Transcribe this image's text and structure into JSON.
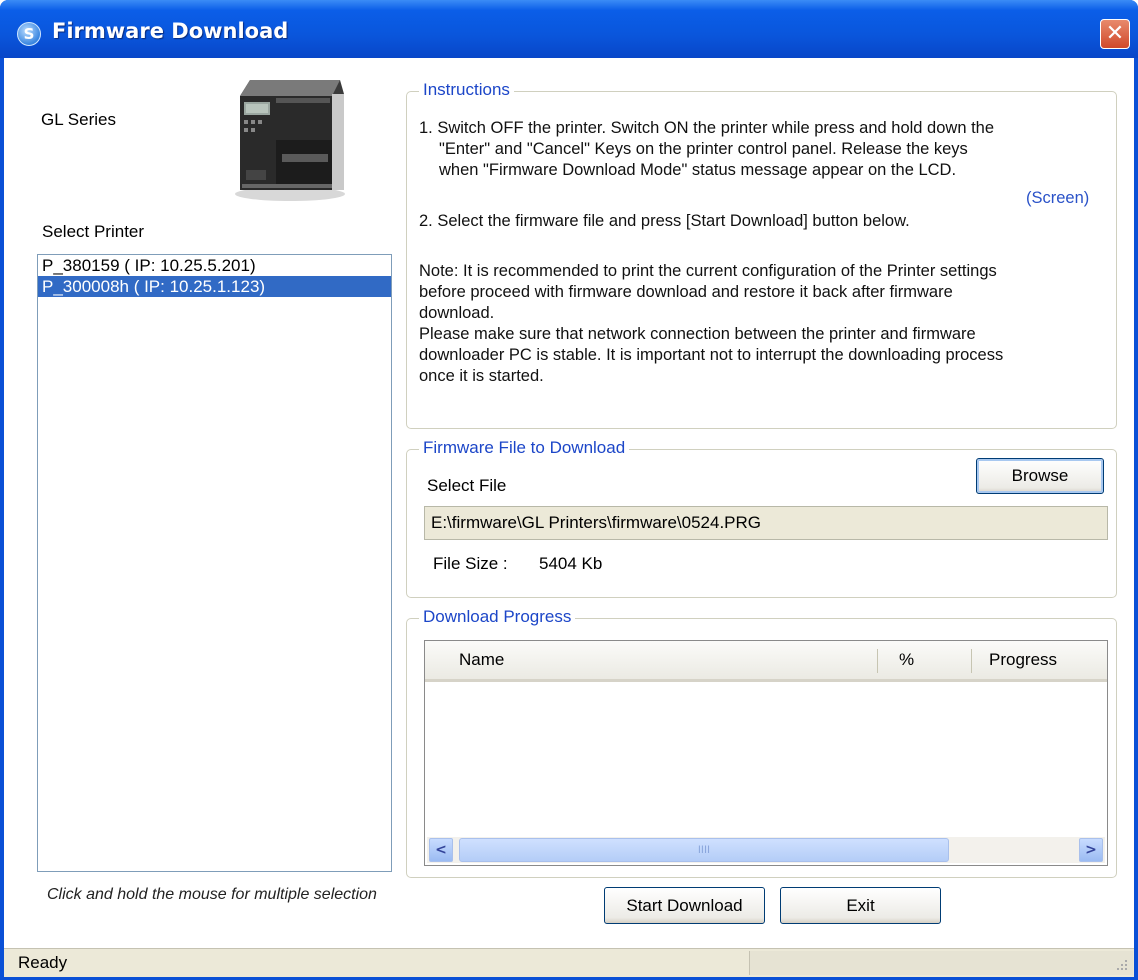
{
  "window": {
    "title": "Firmware Download",
    "close_symbol": "✕"
  },
  "left_panel": {
    "series_label": "GL Series",
    "select_printer_label": "Select Printer",
    "printers": [
      {
        "label": "P_380159 ( IP: 10.25.5.201)",
        "selected": false
      },
      {
        "label": "P_300008h ( IP: 10.25.1.123)",
        "selected": true
      }
    ],
    "hint": "Click and hold the mouse for multiple selection"
  },
  "instructions": {
    "title": "Instructions",
    "step1_line1": "1. Switch OFF the printer. Switch ON the printer while press and hold down the",
    "step1_line2": "\"Enter\"  and \"Cancel\" Keys on the printer control panel. Release the keys",
    "step1_line3": "when \"Firmware Download Mode\" status message appear on the LCD.",
    "screen_link": "(Screen)",
    "step2": "2. Select the firmware file and press [Start Download] button below.",
    "note_lines": [
      "Note: It is recommended to print the current configuration of the Printer settings",
      "before proceed with firmware download and restore it back after firmware",
      "download.",
      "Please make sure that network connection between the printer and firmware",
      "downloader PC is stable. It is important not to interrupt the downloading process",
      "once it is started."
    ]
  },
  "firmware_file": {
    "title": "Firmware File to Download",
    "select_file_label": "Select File",
    "browse_label": "Browse",
    "path": "E:\\firmware\\GL Printers\\firmware\\0524.PRG",
    "file_size_label": "File Size :",
    "file_size_value": "5404 Kb"
  },
  "download_progress": {
    "title": "Download Progress",
    "columns": [
      "Name",
      "%",
      "Progress"
    ],
    "rows": [],
    "scroll_grip": "IIII"
  },
  "buttons": {
    "start_download": "Start Download",
    "exit": "Exit"
  },
  "status_bar": {
    "text": "Ready"
  }
}
